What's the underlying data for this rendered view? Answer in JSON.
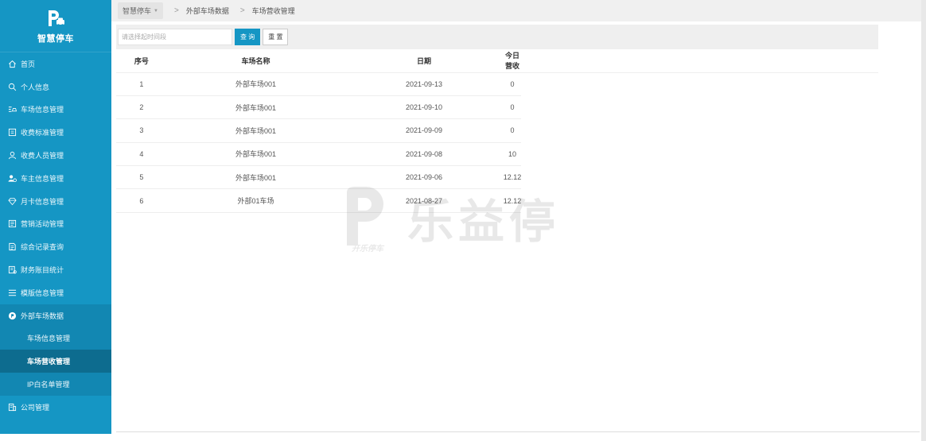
{
  "app": {
    "name": "智慧停车"
  },
  "sidebar": {
    "items": [
      {
        "label": "首页",
        "icon": "home-icon"
      },
      {
        "label": "个人信息",
        "icon": "search-icon"
      },
      {
        "label": "车场信息管理",
        "icon": "parking-icon"
      },
      {
        "label": "收费标准管理",
        "icon": "list-icon"
      },
      {
        "label": "收费人员管理",
        "icon": "user-icon"
      },
      {
        "label": "车主信息管理",
        "icon": "users-icon"
      },
      {
        "label": "月卡信息管理",
        "icon": "diamond-icon"
      },
      {
        "label": "营销活动管理",
        "icon": "document-icon"
      },
      {
        "label": "综合记录查询",
        "icon": "document-icon"
      },
      {
        "label": "财务账目统计",
        "icon": "finance-icon"
      },
      {
        "label": "模版信息管理",
        "icon": "menu-icon"
      },
      {
        "label": "外部车场数据",
        "icon": "badge-icon"
      }
    ],
    "submenu": [
      {
        "label": "车场信息管理"
      },
      {
        "label": "车场营收管理"
      },
      {
        "label": "IP白名单管理"
      }
    ],
    "last": {
      "label": "公司管理",
      "icon": "building-icon"
    }
  },
  "breadcrumb": {
    "first": "智慧停车",
    "second": "外部车场数据",
    "third": "车场营收管理"
  },
  "search": {
    "placeholder": "请选择起时间段",
    "query_label": "查 询",
    "reset_label": "重 置"
  },
  "table": {
    "columns": [
      "序号",
      "车场名称",
      "日期",
      "今日营收"
    ],
    "rows": [
      {
        "no": "1",
        "name": "外部车场001",
        "date": "2021-09-13",
        "revenue": "0"
      },
      {
        "no": "2",
        "name": "外部车场001",
        "date": "2021-09-10",
        "revenue": "0"
      },
      {
        "no": "3",
        "name": "外部车场001",
        "date": "2021-09-09",
        "revenue": "0"
      },
      {
        "no": "4",
        "name": "外部车场001",
        "date": "2021-09-08",
        "revenue": "10"
      },
      {
        "no": "5",
        "name": "外部车场001",
        "date": "2021-09-06",
        "revenue": "12.12"
      },
      {
        "no": "6",
        "name": "外部01车场",
        "date": "2021-08-27",
        "revenue": "12.12"
      }
    ]
  },
  "watermark": {
    "title": "乐益停",
    "subtitle": "开乐停车"
  },
  "colors": {
    "sidebar": "#1596c4",
    "sidebar_active": "#0d6c8f",
    "primary": "#1596c4"
  }
}
